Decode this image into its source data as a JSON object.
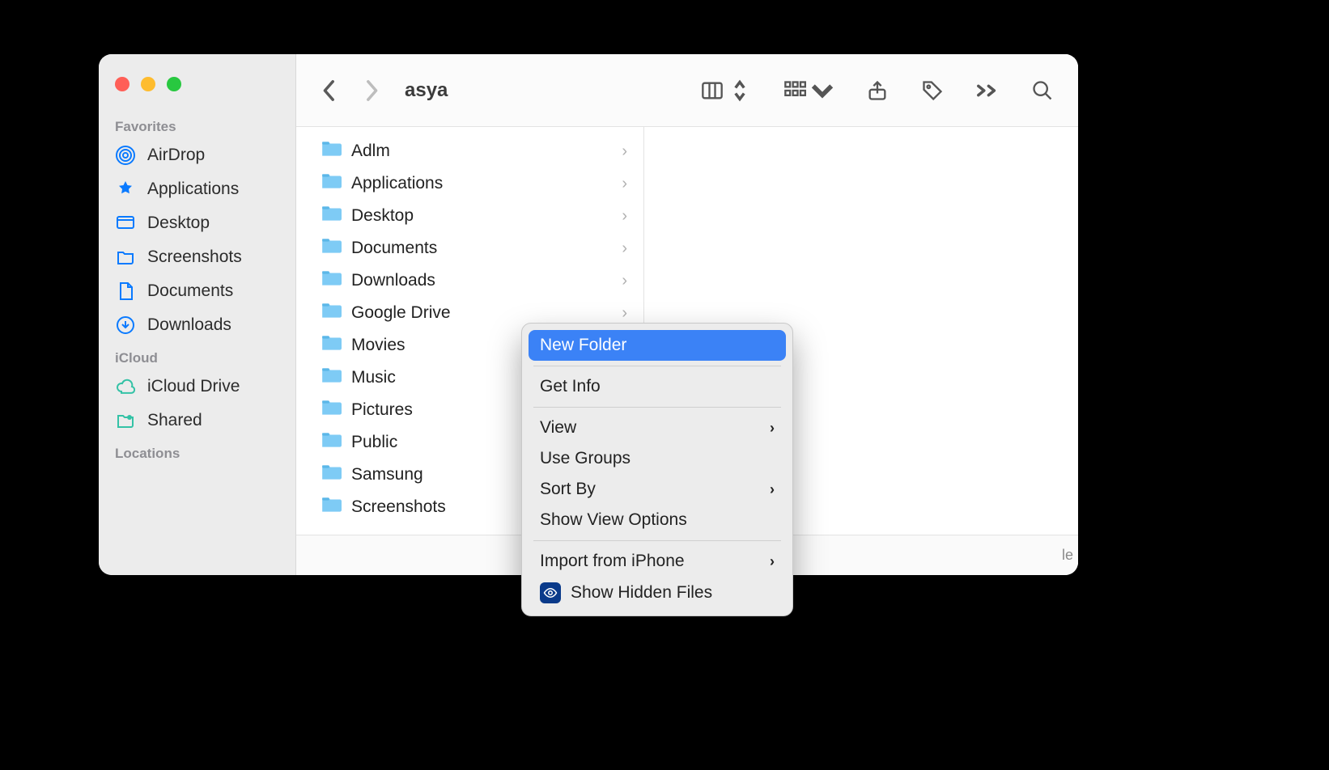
{
  "window_title": "asya",
  "traffic_lights": [
    "close",
    "minimize",
    "zoom"
  ],
  "sidebar": {
    "sections": {
      "favorites": {
        "label": "Favorites",
        "items": [
          {
            "icon": "airdrop",
            "label": "AirDrop"
          },
          {
            "icon": "applications",
            "label": "Applications"
          },
          {
            "icon": "desktop",
            "label": "Desktop"
          },
          {
            "icon": "folder",
            "label": "Screenshots"
          },
          {
            "icon": "document",
            "label": "Documents"
          },
          {
            "icon": "download",
            "label": "Downloads"
          }
        ]
      },
      "icloud": {
        "label": "iCloud",
        "items": [
          {
            "icon": "cloud",
            "label": "iCloud Drive"
          },
          {
            "icon": "shared",
            "label": "Shared"
          }
        ]
      },
      "locations": {
        "label": "Locations",
        "items": []
      }
    }
  },
  "toolbar": {
    "back": "‹",
    "forward": "›",
    "view_mode": "columns",
    "grouping": "icon-grid",
    "share": "share",
    "tags": "tags",
    "more": "»",
    "search": "search"
  },
  "column_items": [
    {
      "label": "Adlm",
      "type": "folder",
      "glyph": ""
    },
    {
      "label": "Applications",
      "type": "folder",
      "glyph": "A"
    },
    {
      "label": "Desktop",
      "type": "folder",
      "glyph": ""
    },
    {
      "label": "Documents",
      "type": "folder",
      "glyph": ""
    },
    {
      "label": "Downloads",
      "type": "folder",
      "glyph": ""
    },
    {
      "label": "Google Drive",
      "type": "folder",
      "glyph": ""
    },
    {
      "label": "Movies",
      "type": "folder",
      "glyph": ""
    },
    {
      "label": "Music",
      "type": "folder",
      "glyph": ""
    },
    {
      "label": "Pictures",
      "type": "folder",
      "glyph": ""
    },
    {
      "label": "Public",
      "type": "folder",
      "glyph": ""
    },
    {
      "label": "Samsung",
      "type": "folder",
      "glyph": ""
    },
    {
      "label": "Screenshots",
      "type": "folder",
      "glyph": ""
    }
  ],
  "status_fragment": "le",
  "context_menu": {
    "groups": [
      [
        {
          "label": "New Folder",
          "selected": true,
          "submenu": false,
          "icon": null
        }
      ],
      [
        {
          "label": "Get Info",
          "selected": false,
          "submenu": false,
          "icon": null
        }
      ],
      [
        {
          "label": "View",
          "selected": false,
          "submenu": true,
          "icon": null
        },
        {
          "label": "Use Groups",
          "selected": false,
          "submenu": false,
          "icon": null
        },
        {
          "label": "Sort By",
          "selected": false,
          "submenu": true,
          "icon": null
        },
        {
          "label": "Show View Options",
          "selected": false,
          "submenu": false,
          "icon": null
        }
      ],
      [
        {
          "label": "Import from iPhone",
          "selected": false,
          "submenu": true,
          "icon": null
        },
        {
          "label": "Show Hidden Files",
          "selected": false,
          "submenu": false,
          "icon": "eye"
        }
      ]
    ]
  }
}
